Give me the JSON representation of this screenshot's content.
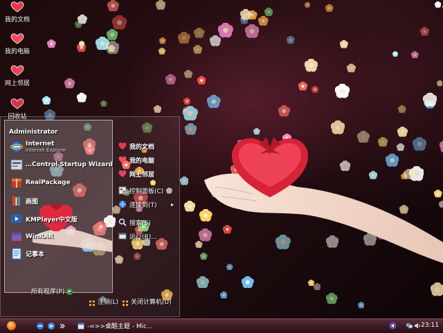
{
  "desktop_icons": [
    {
      "name": "my-documents",
      "label": "我的文档",
      "icon": "heart-folder-icon"
    },
    {
      "name": "my-computer",
      "label": "我的电脑",
      "icon": "heart-computer-icon"
    },
    {
      "name": "network-places",
      "label": "网上邻居",
      "icon": "heart-network-icon"
    },
    {
      "name": "recycle-bin",
      "label": "回收站",
      "icon": "heart-bin-icon"
    }
  ],
  "start_menu": {
    "user": "Administrator",
    "pinned": [
      {
        "label": "Internet",
        "sub": "Internet Explorer",
        "icon": "ie-icon"
      },
      {
        "label": "…Control Startup Wizard",
        "sub": "",
        "icon": "wizard-icon"
      },
      {
        "label": "RealPackage",
        "sub": "",
        "icon": "package-icon"
      },
      {
        "label": "画图",
        "sub": "",
        "icon": "paint-icon"
      },
      {
        "label": "KMPlayer中文版",
        "sub": "",
        "icon": "kmplayer-icon"
      },
      {
        "label": "WinRAR",
        "sub": "",
        "icon": "winrar-icon"
      },
      {
        "label": "记事本",
        "sub": "",
        "icon": "notepad-icon"
      }
    ],
    "all_programs": "所有程序(P)",
    "right_items": [
      {
        "label": "我的文档",
        "bold": true,
        "icon": "heart-folder-icon"
      },
      {
        "label": "我的电脑",
        "bold": true,
        "icon": "heart-computer-icon"
      },
      {
        "label": "网上邻居",
        "bold": true,
        "icon": "heart-network-icon"
      },
      {
        "label": "控制面板(C)",
        "bold": false,
        "icon": "control-panel-icon"
      },
      {
        "label": "连接到(T)",
        "bold": false,
        "icon": "connect-icon"
      },
      {
        "label": "搜索(S)",
        "bold": false,
        "icon": "search-icon"
      },
      {
        "label": "运行(R)...",
        "bold": false,
        "icon": "run-icon"
      }
    ],
    "logoff": "注销(L)",
    "shutdown": "关闭计算机(U)"
  },
  "taskbar": {
    "task_label": "-=>>桌酷主题 - Mic...",
    "clock": "23:11"
  },
  "colors": {
    "heart": "#e83a4a",
    "gift": "#e0283e",
    "taskbar": "#3c1b25",
    "start_orb": "#ff7a1a"
  }
}
